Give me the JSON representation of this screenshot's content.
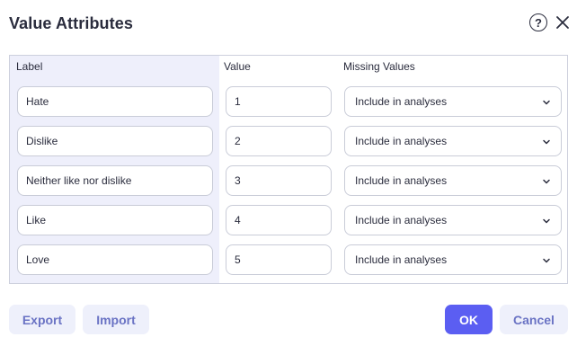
{
  "dialog": {
    "title": "Value Attributes"
  },
  "icons": {
    "help": "?",
    "close": "close-icon",
    "chevron": "chevron-down-icon"
  },
  "table": {
    "headers": {
      "label": "Label",
      "value": "Value",
      "missing": "Missing Values"
    },
    "rows": [
      {
        "label": "Hate",
        "value": "1",
        "missing": "Include in analyses"
      },
      {
        "label": "Dislike",
        "value": "2",
        "missing": "Include in analyses"
      },
      {
        "label": "Neither like nor dislike",
        "value": "3",
        "missing": "Include in analyses"
      },
      {
        "label": "Like",
        "value": "4",
        "missing": "Include in analyses"
      },
      {
        "label": "Love",
        "value": "5",
        "missing": "Include in analyses"
      }
    ]
  },
  "footer": {
    "export": "Export",
    "import": "Import",
    "ok": "OK",
    "cancel": "Cancel"
  },
  "colors": {
    "accent": "#5b5ef2",
    "label_column_bg": "#eeeffb",
    "soft_button_bg": "#eef0fb",
    "soft_button_text": "#6a73c4"
  }
}
